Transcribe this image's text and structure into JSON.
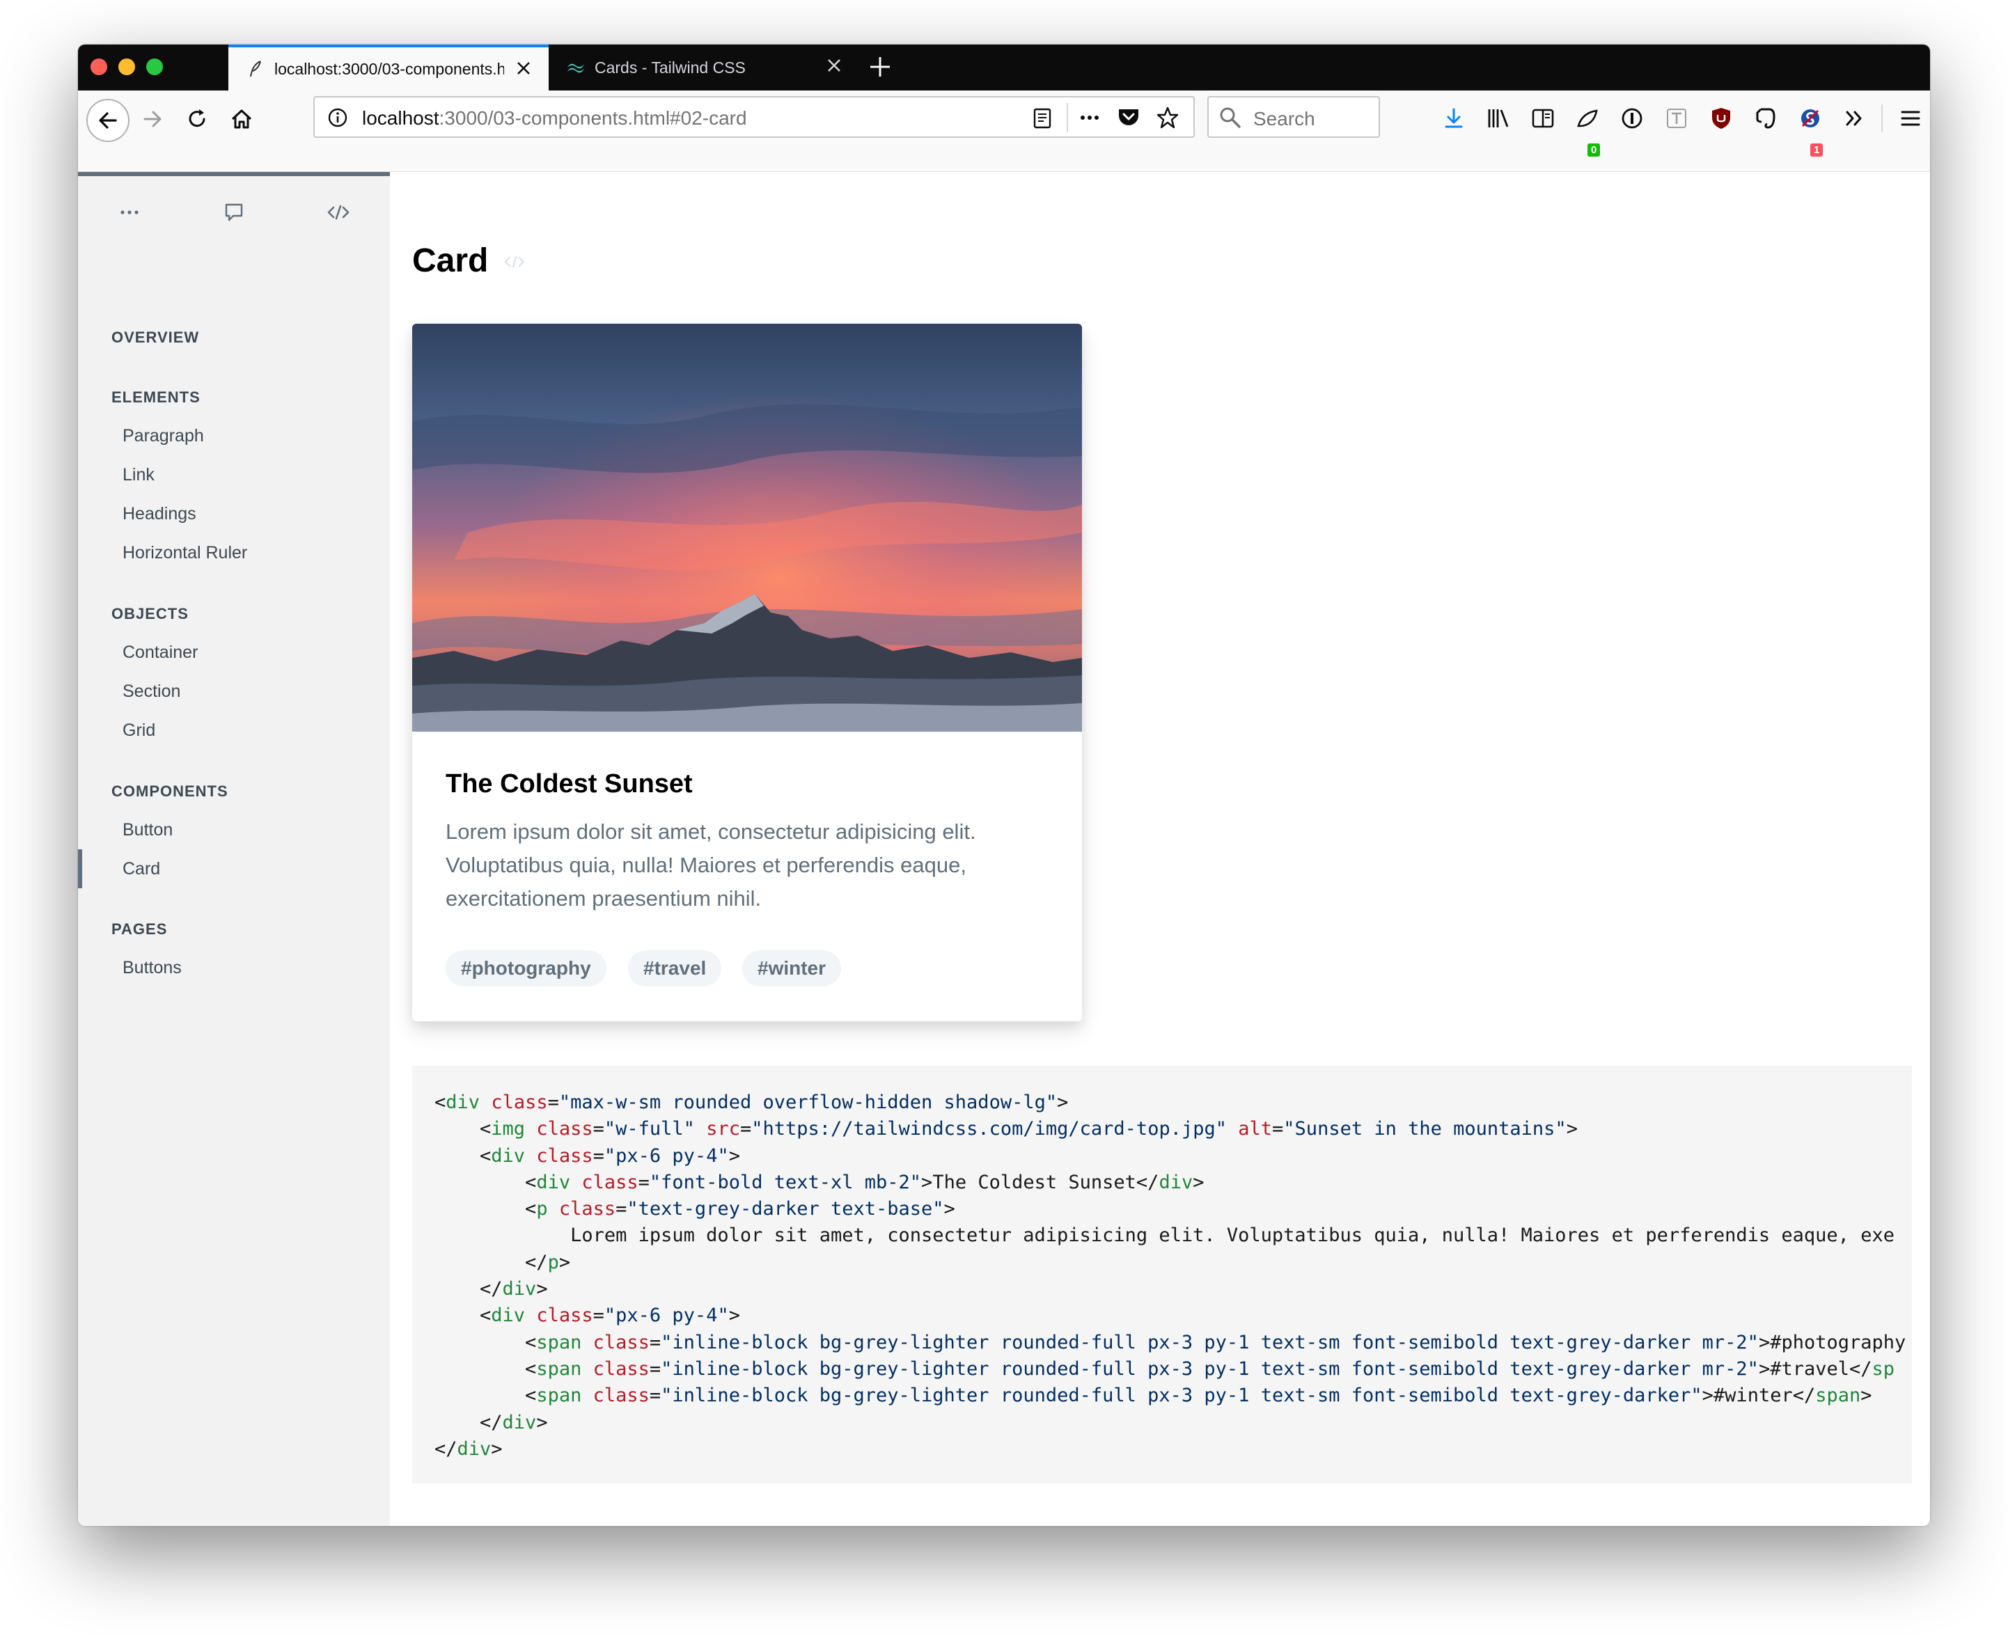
{
  "browser": {
    "tabs": [
      {
        "label": "localhost:3000/03-components.html#02-card",
        "active": true
      },
      {
        "label": "Cards - Tailwind CSS",
        "active": false
      }
    ],
    "url_host": "localhost",
    "url_rest": ":3000/03-components.html#02-card",
    "search_placeholder": "Search",
    "badges": {
      "extension_a": "0",
      "extension_b": "1"
    },
    "accent_color": "#0a84ff"
  },
  "sidebar": {
    "top_icons": [
      "more-icon",
      "comment-icon",
      "code-icon"
    ],
    "overview": "OVERVIEW",
    "sections": [
      {
        "title": "ELEMENTS",
        "items": [
          "Paragraph",
          "Link",
          "Headings",
          "Horizontal Ruler"
        ]
      },
      {
        "title": "OBJECTS",
        "items": [
          "Container",
          "Section",
          "Grid"
        ]
      },
      {
        "title": "COMPONENTS",
        "items": [
          "Button",
          "Card"
        ]
      },
      {
        "title": "PAGES",
        "items": [
          "Buttons"
        ]
      }
    ],
    "active_item": "Card"
  },
  "main": {
    "title": "Card",
    "card": {
      "image_alt": "Sunset in the mountains",
      "title": "The Coldest Sunset",
      "text": "Lorem ipsum dolor sit amet, consectetur adipisicing elit. Voluptatibus quia, nulla! Maiores et perferendis eaque, exercitationem praesentium nihil.",
      "tags": [
        "#photography",
        "#travel",
        "#winter"
      ]
    },
    "code": {
      "l1_tag": "div",
      "l1_class": "\"max-w-sm rounded overflow-hidden shadow-lg\"",
      "l2_tag": "img",
      "l2_class": "\"w-full\"",
      "l2_src": "\"https://tailwindcss.com/img/card-top.jpg\"",
      "l2_alt": "\"Sunset in the mountains\"",
      "l3_tag": "div",
      "l3_class": "\"px-6 py-4\"",
      "l4_tag": "div",
      "l4_class": "\"font-bold text-xl mb-2\"",
      "l4_text": "The Coldest Sunset",
      "l4_close": "div",
      "l5_tag": "p",
      "l5_class": "\"text-grey-darker text-base\"",
      "l6_text": "Lorem ipsum dolor sit amet, consectetur adipisicing elit. Voluptatibus quia, nulla! Maiores et perferendis eaque, exe",
      "l7_close": "p",
      "l8_close": "div",
      "l9_tag": "div",
      "l9_class": "\"px-6 py-4\"",
      "l10_tag": "span",
      "l10_class": "\"inline-block bg-grey-lighter rounded-full px-3 py-1 text-sm font-semibold text-grey-darker mr-2\"",
      "l10_text": "#photography",
      "l11_tag": "span",
      "l11_class": "\"inline-block bg-grey-lighter rounded-full px-3 py-1 text-sm font-semibold text-grey-darker mr-2\"",
      "l11_text": "#travel",
      "l11_close": "sp",
      "l12_tag": "span",
      "l12_class": "\"inline-block bg-grey-lighter rounded-full px-3 py-1 text-sm font-semibold text-grey-darker\"",
      "l12_text": "#winter",
      "l12_close": "span",
      "l13_close": "div",
      "l14_close": "div",
      "attr_class": "class",
      "attr_src": "src",
      "attr_alt": "alt"
    }
  }
}
